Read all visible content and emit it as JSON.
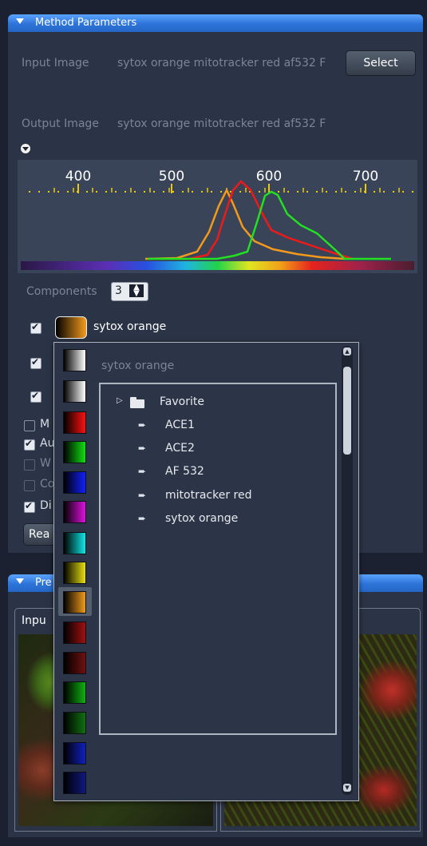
{
  "method_parameters": {
    "title": "Method Parameters",
    "input_label": "Input Image",
    "input_value": "sytox orange mitotracker red af532 F",
    "select_label": "Select",
    "output_label": "Output Image",
    "output_value": "sytox orange mitotracker red af532 F"
  },
  "spectrum": {
    "tick_labels": [
      "400",
      "500",
      "600",
      "700"
    ],
    "colors": {
      "orange": "#f39a1c",
      "red": "#ee1a1a",
      "green": "#22e022"
    }
  },
  "components": {
    "label": "Components",
    "count": "3",
    "rows": [
      {
        "checked": true,
        "name": "sytox orange"
      },
      {
        "checked": true,
        "name": ""
      },
      {
        "checked": true,
        "name": ""
      }
    ]
  },
  "options_partial": [
    "M",
    "Au",
    "W",
    "Co",
    "Di"
  ],
  "read_button_partial": "Rea",
  "preview": {
    "title_partial": "Pre",
    "input_tab_partial": "Inpu"
  },
  "color_popup": {
    "current_name": "sytox orange",
    "swatches": [
      "white-gradient",
      "white-gradient",
      "red",
      "green",
      "blue",
      "magenta",
      "cyan",
      "yellow",
      "orange",
      "dark-red",
      "darker-red",
      "green-2",
      "dark-green",
      "blue-2",
      "dark-blue"
    ]
  },
  "dye_tree": {
    "folder": "Favorite",
    "items": [
      "ACE1",
      "ACE2",
      "AF 532",
      "mitotracker red",
      "sytox orange"
    ]
  }
}
